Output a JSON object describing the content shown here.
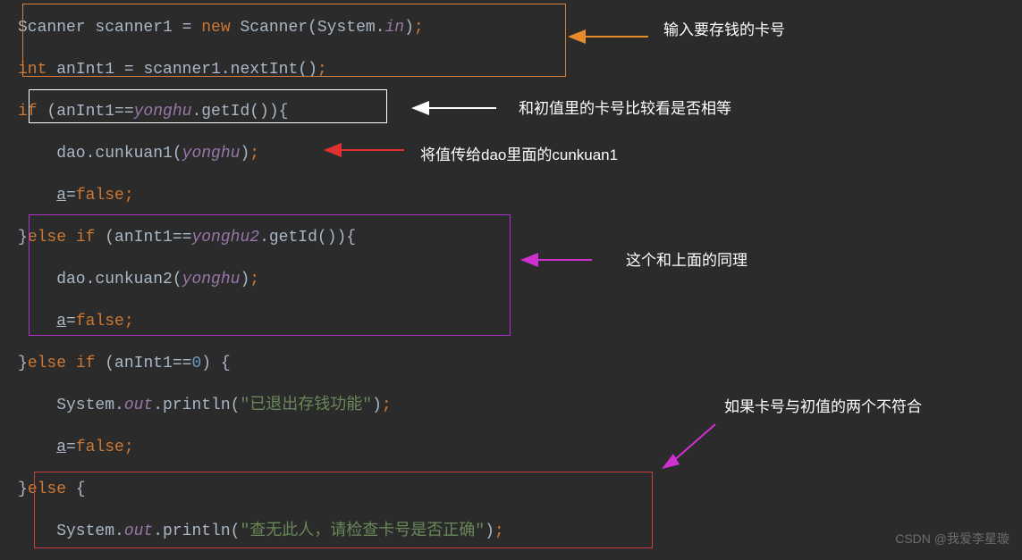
{
  "code": {
    "line1": {
      "tokens": [
        {
          "t": "Scanner scanner1 ",
          "c": "type"
        },
        {
          "t": "= ",
          "c": "paren"
        },
        {
          "t": "new ",
          "c": "kw"
        },
        {
          "t": "Scanner(System.",
          "c": "type"
        },
        {
          "t": "in",
          "c": "field"
        },
        {
          "t": ")",
          "c": "paren"
        },
        {
          "t": ";",
          "c": "semi"
        }
      ]
    },
    "line2": {
      "tokens": [
        {
          "t": "int ",
          "c": "kw"
        },
        {
          "t": "anInt1 ",
          "c": "var"
        },
        {
          "t": "= ",
          "c": "paren"
        },
        {
          "t": "scanner1.nextInt()",
          "c": "var"
        },
        {
          "t": ";",
          "c": "semi"
        }
      ]
    },
    "line3": {
      "tokens": [
        {
          "t": "if ",
          "c": "kw"
        },
        {
          "t": "(anInt1==",
          "c": "paren"
        },
        {
          "t": "yonghu",
          "c": "field"
        },
        {
          "t": ".getId()){",
          "c": "paren"
        }
      ]
    },
    "line4": {
      "tokens": [
        {
          "t": "    dao.cunkuan1(",
          "c": "var"
        },
        {
          "t": "yonghu",
          "c": "field"
        },
        {
          "t": ")",
          "c": "paren"
        },
        {
          "t": ";",
          "c": "semi"
        }
      ]
    },
    "line5": {
      "tokens": [
        {
          "t": "    ",
          "c": "var"
        },
        {
          "t": "a",
          "c": "var underline"
        },
        {
          "t": "=",
          "c": "paren"
        },
        {
          "t": "false",
          "c": "kw"
        },
        {
          "t": ";",
          "c": "semi"
        }
      ]
    },
    "line6": {
      "tokens": [
        {
          "t": "}",
          "c": "paren"
        },
        {
          "t": "else if ",
          "c": "kw"
        },
        {
          "t": "(anInt1==",
          "c": "paren"
        },
        {
          "t": "yonghu2",
          "c": "field"
        },
        {
          "t": ".getId()){",
          "c": "paren"
        }
      ]
    },
    "line7": {
      "tokens": [
        {
          "t": "    dao.cunkuan2(",
          "c": "var"
        },
        {
          "t": "yonghu",
          "c": "field"
        },
        {
          "t": ")",
          "c": "paren"
        },
        {
          "t": ";",
          "c": "semi"
        }
      ]
    },
    "line8": {
      "tokens": [
        {
          "t": "    ",
          "c": "var"
        },
        {
          "t": "a",
          "c": "var underline"
        },
        {
          "t": "=",
          "c": "paren"
        },
        {
          "t": "false",
          "c": "kw"
        },
        {
          "t": ";",
          "c": "semi"
        }
      ]
    },
    "line9": {
      "tokens": [
        {
          "t": "}",
          "c": "paren"
        },
        {
          "t": "else if ",
          "c": "kw"
        },
        {
          "t": "(anInt1==",
          "c": "paren"
        },
        {
          "t": "0",
          "c": "num"
        },
        {
          "t": ") {",
          "c": "paren"
        }
      ]
    },
    "line10": {
      "tokens": [
        {
          "t": "    System.",
          "c": "var"
        },
        {
          "t": "out",
          "c": "field"
        },
        {
          "t": ".println(",
          "c": "var"
        },
        {
          "t": "\"已退出存钱功能\"",
          "c": "str"
        },
        {
          "t": ")",
          "c": "paren"
        },
        {
          "t": ";",
          "c": "semi"
        }
      ]
    },
    "line11": {
      "tokens": [
        {
          "t": "    ",
          "c": "var"
        },
        {
          "t": "a",
          "c": "var underline"
        },
        {
          "t": "=",
          "c": "paren"
        },
        {
          "t": "false",
          "c": "kw"
        },
        {
          "t": ";",
          "c": "semi"
        }
      ]
    },
    "line12": {
      "tokens": [
        {
          "t": "}",
          "c": "paren"
        },
        {
          "t": "else ",
          "c": "kw"
        },
        {
          "t": "{",
          "c": "paren"
        }
      ]
    },
    "line13": {
      "tokens": [
        {
          "t": "    System.",
          "c": "var"
        },
        {
          "t": "out",
          "c": "field"
        },
        {
          "t": ".println(",
          "c": "var"
        },
        {
          "t": "\"查无此人，请检查卡号是否正确\"",
          "c": "str"
        },
        {
          "t": ")",
          "c": "paren"
        },
        {
          "t": ";",
          "c": "semi"
        }
      ]
    }
  },
  "annotations": {
    "a1": "输入要存钱的卡号",
    "a2": "和初值里的卡号比较看是否相等",
    "a3": "将值传给dao里面的cunkuan1",
    "a4": "这个和上面的同理",
    "a5": "如果卡号与初值的两个不符合"
  },
  "watermark": "CSDN @我爱李星璇"
}
